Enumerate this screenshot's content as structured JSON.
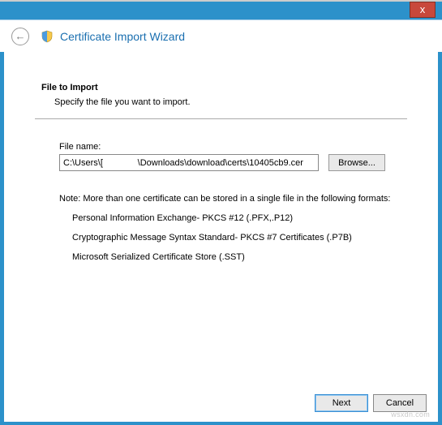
{
  "window": {
    "close_label": "x"
  },
  "header": {
    "title": "Certificate Import Wizard",
    "back_icon": "←"
  },
  "main": {
    "section_heading": "File to Import",
    "section_desc": "Specify the file you want to import.",
    "file_label": "File name:",
    "file_value": "C:\\Users\\[              \\Downloads\\download\\certs\\10405cb9.cer",
    "browse_label": "Browse...",
    "note": "Note:  More than one certificate can be stored in a single file in the following formats:",
    "formats": [
      "Personal Information Exchange- PKCS #12 (.PFX,.P12)",
      "Cryptographic Message Syntax Standard- PKCS #7 Certificates (.P7B)",
      "Microsoft Serialized Certificate Store (.SST)"
    ]
  },
  "buttons": {
    "next": "Next",
    "cancel": "Cancel"
  },
  "watermark": "wsxdn.com"
}
